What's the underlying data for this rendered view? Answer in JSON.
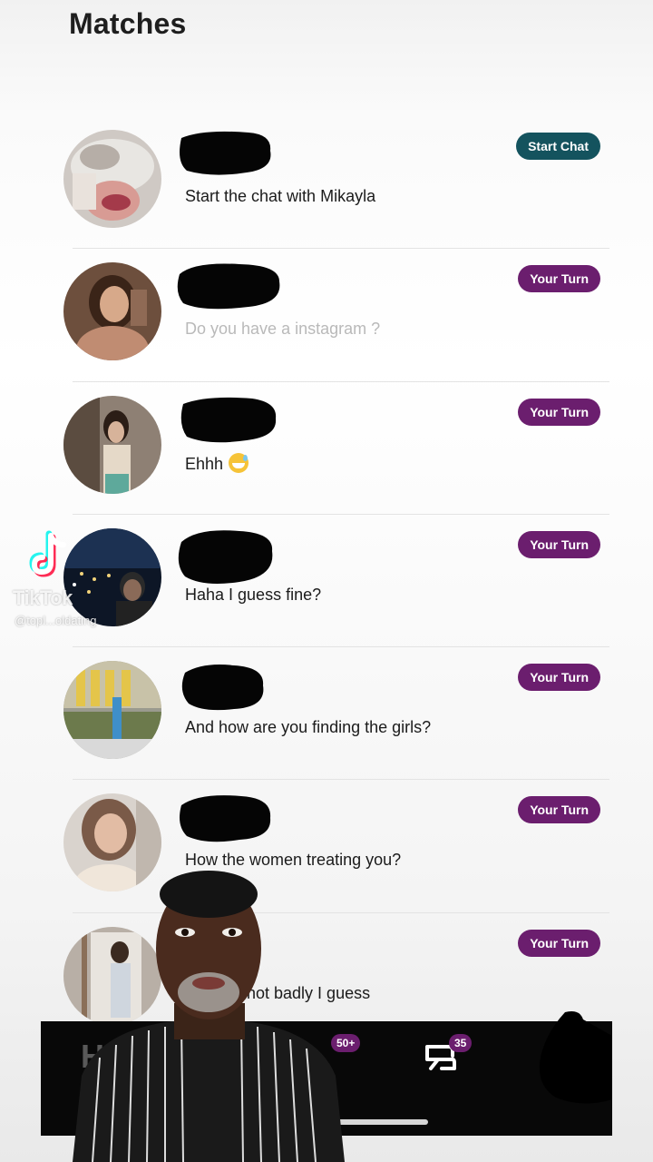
{
  "header": {
    "title": "Matches"
  },
  "matches": [
    {
      "message": "Start the chat with Mikayla",
      "status": "Start Chat",
      "message_style": "normal"
    },
    {
      "message": "Do you have a instagram ?",
      "status": "Your Turn",
      "message_style": "muted"
    },
    {
      "message": "Ehhh",
      "status": "Your Turn",
      "message_style": "normal",
      "emoji": "grinning-sweat-face"
    },
    {
      "message": "Haha I guess fine?",
      "status": "Your Turn",
      "message_style": "normal"
    },
    {
      "message": "And how are you finding the girls?",
      "status": "Your Turn",
      "message_style": "normal"
    },
    {
      "message": "How the women treating you?",
      "status": "Your Turn",
      "message_style": "normal"
    },
    {
      "message": "not badly I guess",
      "status": "Your Turn",
      "message_style": "normal"
    }
  ],
  "nav": {
    "home_label_fragment": "H",
    "likes_badge": "50+",
    "chats_badge": "35"
  },
  "watermark": {
    "brand": "TikTok",
    "handle": "@topl...oldating"
  },
  "colors": {
    "start_chat_badge": "#14535e",
    "your_turn_badge": "#6b1e6e",
    "nav_background": "#080808",
    "muted_text": "#b9b9b9"
  }
}
